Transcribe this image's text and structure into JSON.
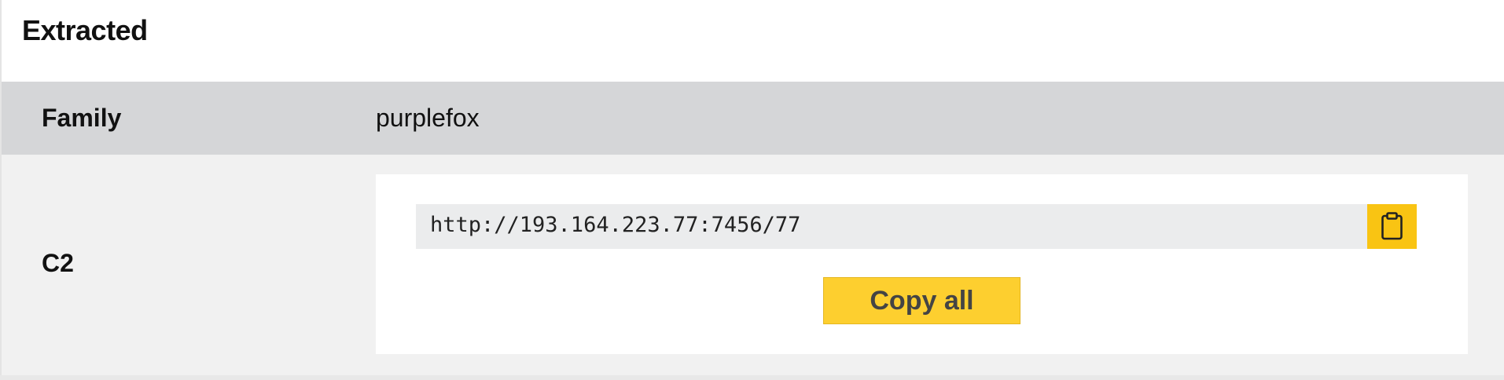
{
  "panel": {
    "title": "Extracted"
  },
  "rows": {
    "family": {
      "label": "Family",
      "value": "purplefox"
    },
    "c2": {
      "label": "C2",
      "value": "http://193.164.223.77:7456/77",
      "copy_icon": "clipboard-icon",
      "copy_all_label": "Copy all"
    }
  },
  "colors": {
    "header_bg": "#ffffff",
    "family_row_bg": "#d5d6d8",
    "c2_row_bg": "#f1f1f1",
    "field_bg": "#ebeced",
    "accent": "#f9c413",
    "copy_all_bg": "#fdcf2f"
  }
}
